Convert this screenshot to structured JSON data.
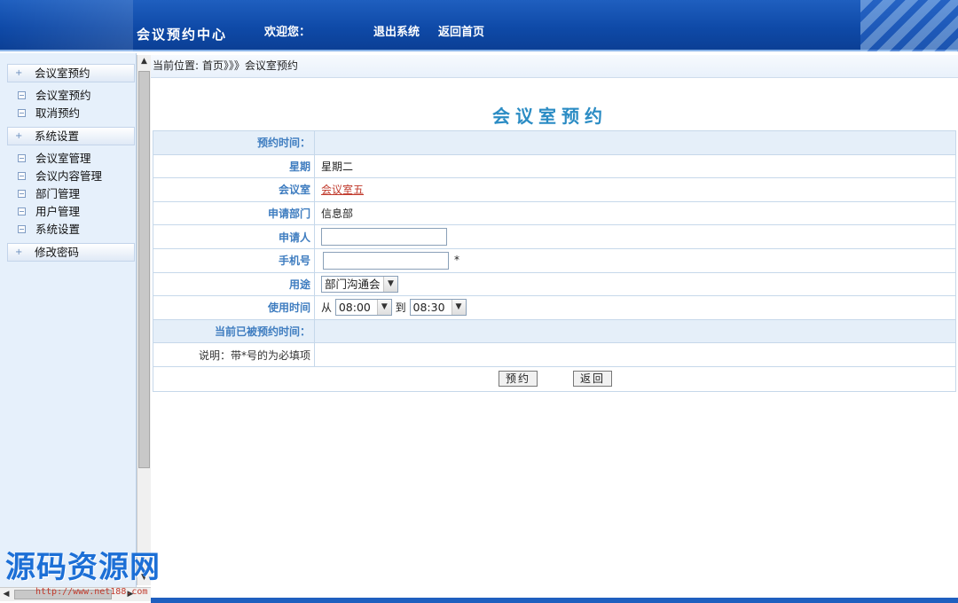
{
  "header": {
    "brand": "会议预约中心",
    "welcome": "欢迎您：",
    "logout": "退出系统",
    "home": "返回首页"
  },
  "sidebar": {
    "sections": [
      {
        "label": "会议室预约",
        "items": [
          "会议室预约",
          "取消预约"
        ]
      },
      {
        "label": "系统设置",
        "items": [
          "会议室管理",
          "会议内容管理",
          "部门管理",
          "用户管理",
          "系统设置"
        ]
      },
      {
        "label": "修改密码",
        "items": []
      }
    ]
  },
  "breadcrumb": "当前位置: 首页》》》会议室预约",
  "page_title": "会议室预约",
  "form": {
    "time_label": "预约时间：",
    "week_label": "星期",
    "week_value": "星期二",
    "room_label": "会议室",
    "room_value": "会议室五",
    "dept_label": "申请部门",
    "dept_value": "信息部",
    "applicant_label": "申请人",
    "phone_label": "手机号",
    "required_mark": "*",
    "purpose_label": "用途",
    "purpose_value": "部门沟通会",
    "use_time_label": "使用时间",
    "from_label": "从",
    "from_value": "08:00",
    "to_label": "到",
    "to_value": "08:30",
    "booked_label": "当前已被预约时间：",
    "note_label": "说明：带*号的为必填项"
  },
  "buttons": {
    "submit": "预约",
    "back": "返回"
  },
  "watermark": {
    "text": "源码资源网",
    "url": "http://www.net188.com"
  }
}
